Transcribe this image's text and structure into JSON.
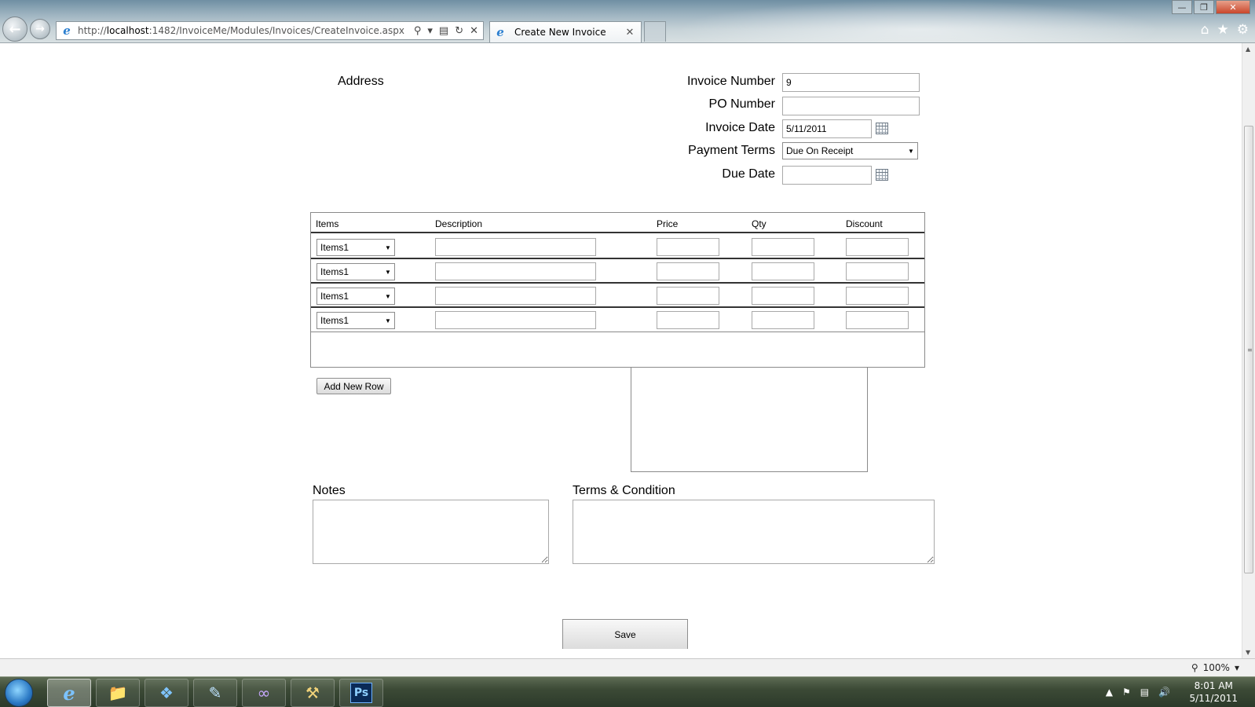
{
  "browser": {
    "url_prefix": "http://",
    "url_host": "localhost",
    "url_rest": ":1482/InvoiceMe/Modules/Invoices/CreateInvoice.aspx",
    "tab_title": "Create New Invoice",
    "zoom": "100%"
  },
  "form": {
    "address_label": "Address",
    "invoice_number_label": "Invoice Number",
    "invoice_number_value": "9",
    "po_number_label": "PO Number",
    "po_number_value": "",
    "invoice_date_label": "Invoice Date",
    "invoice_date_value": "5/11/2011",
    "payment_terms_label": "Payment Terms",
    "payment_terms_value": "Due On Receipt",
    "due_date_label": "Due Date",
    "due_date_value": ""
  },
  "grid": {
    "columns": [
      "Items",
      "Description",
      "Price",
      "Qty",
      "Discount"
    ],
    "rows": [
      {
        "item": "Items1"
      },
      {
        "item": "Items1"
      },
      {
        "item": "Items1"
      },
      {
        "item": "Items1"
      }
    ]
  },
  "actions": {
    "add_row_label": "Add New Row",
    "save_label": "Save"
  },
  "notes": {
    "notes_label": "Notes",
    "terms_label": "Terms & Condition"
  },
  "taskbar": {
    "time": "8:01 AM",
    "date": "5/11/2011",
    "ps_label": "Ps"
  }
}
